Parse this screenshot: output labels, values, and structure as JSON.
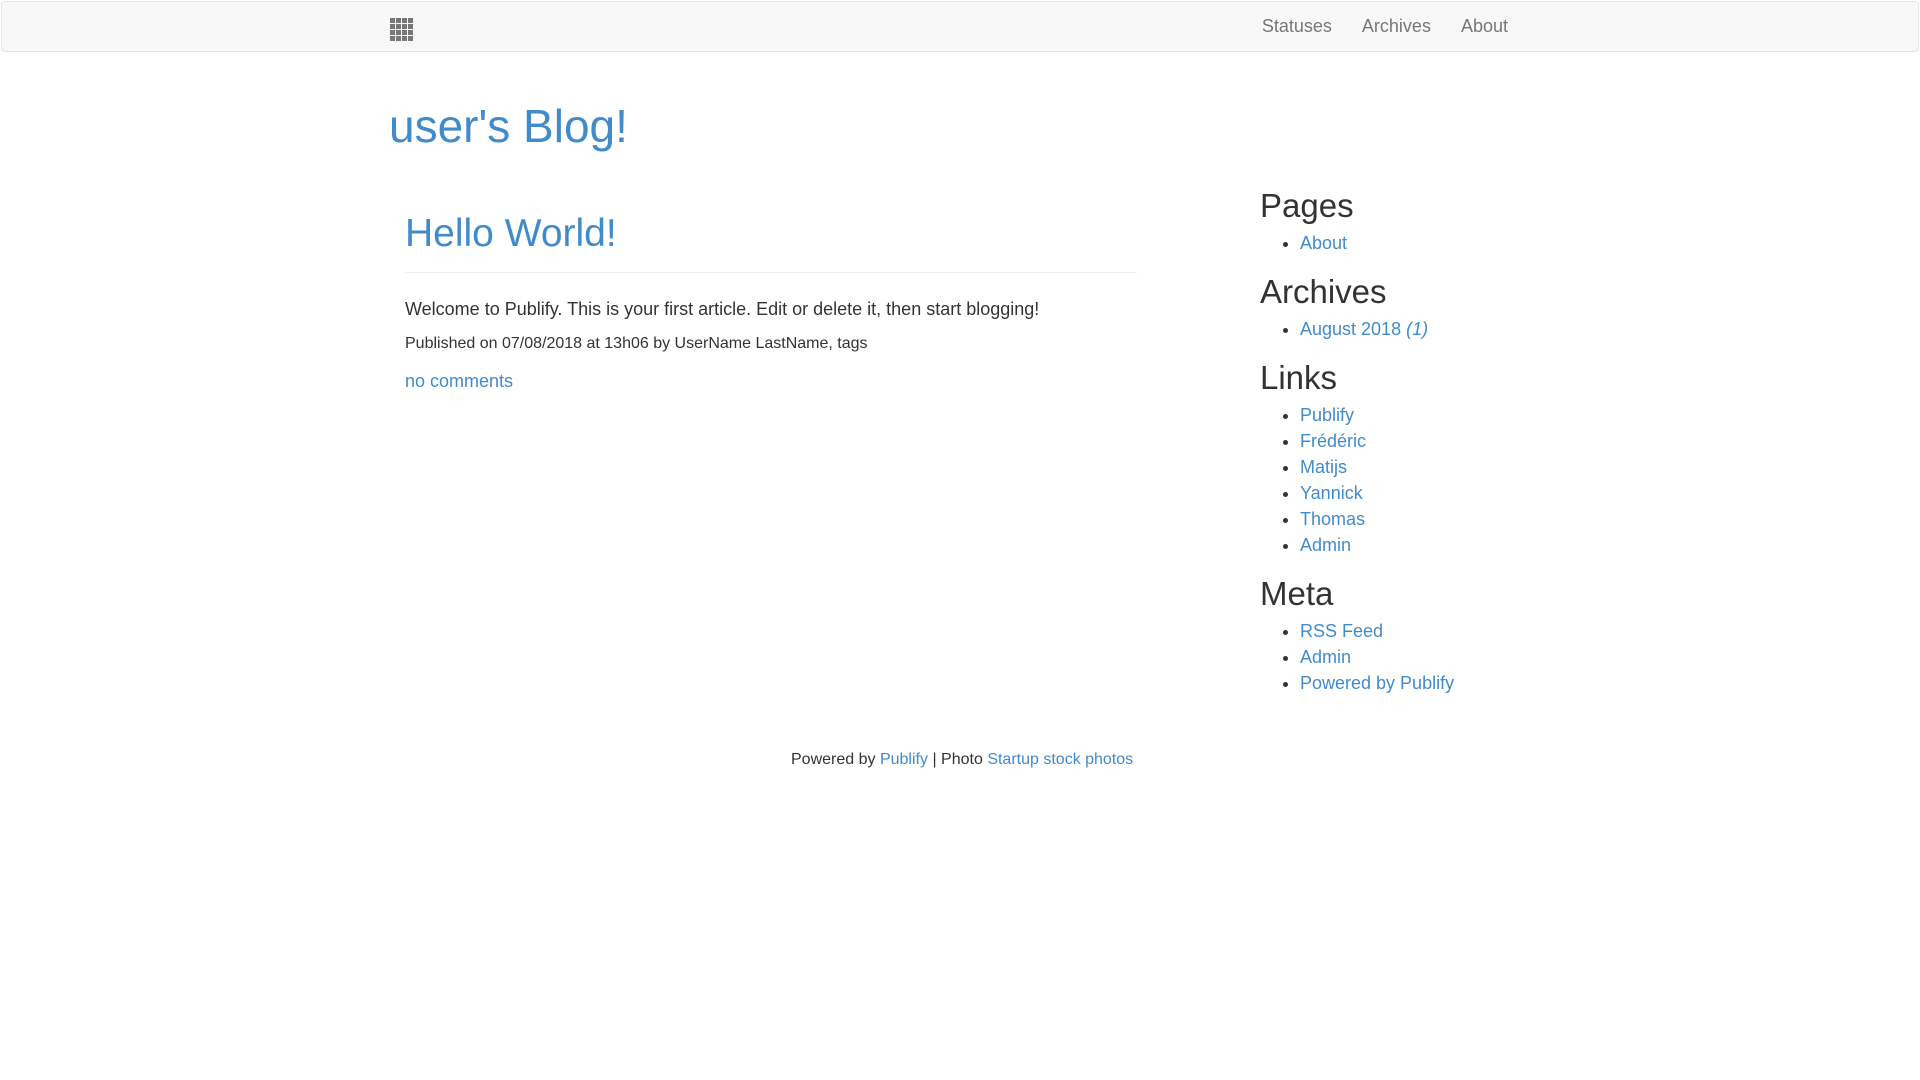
{
  "navbar": {
    "brand_icon": "apps-grid-icon",
    "items": [
      {
        "label": "Statuses"
      },
      {
        "label": "Archives"
      },
      {
        "label": "About"
      }
    ]
  },
  "blog": {
    "title": "user's Blog!"
  },
  "article": {
    "title": "Hello World!",
    "body": "Welcome to Publify. This is your first article. Edit or delete it, then start blogging!",
    "meta": "Published on 07/08/2018 at 13h06 by UserName LastName, tags",
    "comments": "no comments"
  },
  "sidebar": {
    "pages": {
      "heading": "Pages",
      "items": [
        {
          "label": "About"
        }
      ]
    },
    "archives": {
      "heading": "Archives",
      "items": [
        {
          "label": "August 2018",
          "count": "(1)"
        }
      ]
    },
    "links": {
      "heading": "Links",
      "items": [
        {
          "label": "Publify"
        },
        {
          "label": "Frédéric"
        },
        {
          "label": "Matijs"
        },
        {
          "label": "Yannick"
        },
        {
          "label": "Thomas"
        },
        {
          "label": "Admin"
        }
      ]
    },
    "meta": {
      "heading": "Meta",
      "items": [
        {
          "label": "RSS Feed"
        },
        {
          "label": "Admin"
        },
        {
          "label": "Powered by Publify"
        }
      ]
    }
  },
  "footer": {
    "powered_by_text": "Powered by",
    "publify_link": "Publify",
    "separator_text": "| Photo",
    "photo_link": "Startup stock photos"
  },
  "colors": {
    "link": "#428bca",
    "text": "#333333",
    "navbar_bg": "#f8f8f8",
    "navbar_text": "#777777"
  }
}
